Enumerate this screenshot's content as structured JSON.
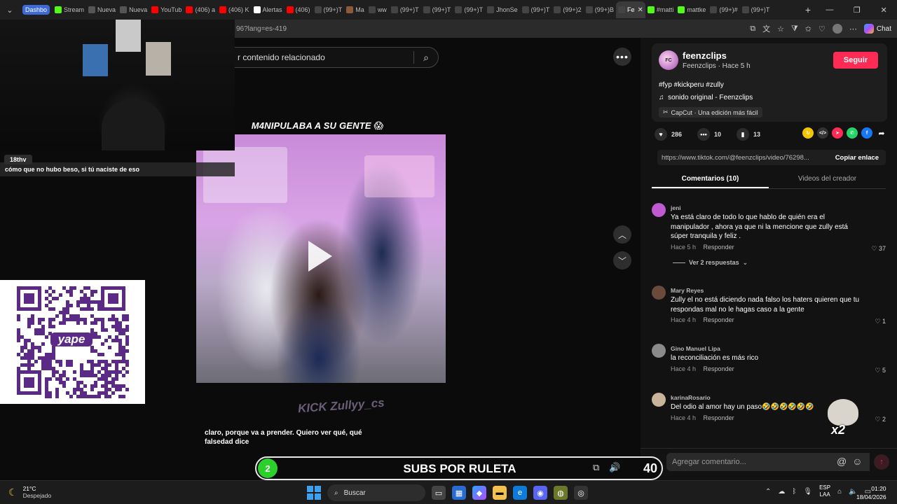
{
  "browser": {
    "tabs": [
      {
        "label": "Dashbo",
        "color": "#3d6ad6",
        "first": true
      },
      {
        "label": "Stream",
        "color": "#53fc18"
      },
      {
        "label": "Nueva",
        "color": "#555555"
      },
      {
        "label": "Nueva",
        "color": "#555555"
      },
      {
        "label": "YouTub",
        "color": "#ff0000"
      },
      {
        "label": "(406) a",
        "color": "#ff0000"
      },
      {
        "label": "(406) K",
        "color": "#ff0000"
      },
      {
        "label": "Alertas",
        "color": "#ffffff"
      },
      {
        "label": "(406)",
        "color": "#ff0000"
      },
      {
        "label": "(99+)T",
        "color": "#444444"
      },
      {
        "label": "Ma",
        "color": "#8a5a3a"
      },
      {
        "label": "ww",
        "color": "#444444"
      },
      {
        "label": "(99+)T",
        "color": "#444444"
      },
      {
        "label": "(99+)T",
        "color": "#444444"
      },
      {
        "label": "(99+)T",
        "color": "#444444"
      },
      {
        "label": "JhonSe",
        "color": "#444444"
      },
      {
        "label": "(99+)T",
        "color": "#444444"
      },
      {
        "label": "(99+)2",
        "color": "#444444"
      },
      {
        "label": "(99+)B",
        "color": "#444444"
      },
      {
        "label": "Fe",
        "color": "#444444",
        "active": true
      },
      {
        "label": "#matti",
        "color": "#53fc18"
      },
      {
        "label": "mattke",
        "color": "#53fc18"
      },
      {
        "label": "(99+)#",
        "color": "#444444"
      },
      {
        "label": "(99+)T",
        "color": "#444444"
      }
    ],
    "new_tab": "+",
    "close_tab": "✕",
    "url": "96?lang=es-419",
    "chat_label": "Chat"
  },
  "search": {
    "placeholder": "r contenido relacionado"
  },
  "video": {
    "caption": "M4NIPULABA A SU GENTE 😱",
    "subtitle": "claro, porque va a prender. Quiero ver qué, qué falsedad dice",
    "watermark": "KICK Zullyy_cs"
  },
  "stream_overlay": {
    "chat_user": "18thv",
    "chat_message": "cómo que no hubo beso, si tú naciste de eso",
    "qr_label": "yape"
  },
  "roulette": {
    "badge": "2",
    "title": "SUBS POR RULETA",
    "count": "40"
  },
  "creator": {
    "name": "feenzclips",
    "meta": "Feenzclips · Hace 5 h",
    "follow_label": "Seguir",
    "tags": "#fyp #kickperu #zully",
    "sound": "sonido original - Feenzclips",
    "capcut": "CapCut · Una edición más fácil"
  },
  "actions": {
    "likes": "286",
    "comments": "10",
    "saves": "13"
  },
  "share": {
    "link": "https://www.tiktok.com/@feenzclips/video/76298...",
    "copy_label": "Copiar enlace"
  },
  "panel_tabs": [
    {
      "label": "Comentarios (10)",
      "active": true
    },
    {
      "label": "Videos del creador",
      "active": false
    }
  ],
  "comments": [
    {
      "user": "jeni",
      "text": "Ya está claro de todo lo que hablo de quién era el manipulador , ahora ya que ni la mencione que zully está súper tranquila y feliz .",
      "time": "Hace 5 h",
      "reply": "Responder",
      "likes": "37",
      "replies": "Ver 2 respuestas",
      "avatar_color": "#c05ad0"
    },
    {
      "user": "Mary Reyes",
      "text": "Zully el no está diciendo nada falso los haters quieren que tu respondas mal no le hagas caso a la gente",
      "time": "Hace 4 h",
      "reply": "Responder",
      "likes": "1",
      "avatar_color": "#6a4a3a"
    },
    {
      "user": "Gino Manuel Lipa",
      "text": "la reconciliación es más rico",
      "time": "Hace 4 h",
      "reply": "Responder",
      "likes": "5",
      "avatar_color": "#8a8a8a"
    },
    {
      "user": "karinaRosario",
      "text": "Del odio al amor hay un paso🤣🤣🤣🤣🤣🤣",
      "time": "Hace 4 h",
      "reply": "Responder",
      "likes": "2",
      "avatar_color": "#c8b49a"
    }
  ],
  "sticker": {
    "label": "x2"
  },
  "comment_box": {
    "placeholder": "Agregar comentario..."
  },
  "taskbar": {
    "temp": "21°C",
    "weather": "Despejado",
    "search": "Buscar",
    "lang_top": "ESP",
    "lang_bottom": "LAA",
    "time": "01:20",
    "date": "18/04/2026"
  }
}
